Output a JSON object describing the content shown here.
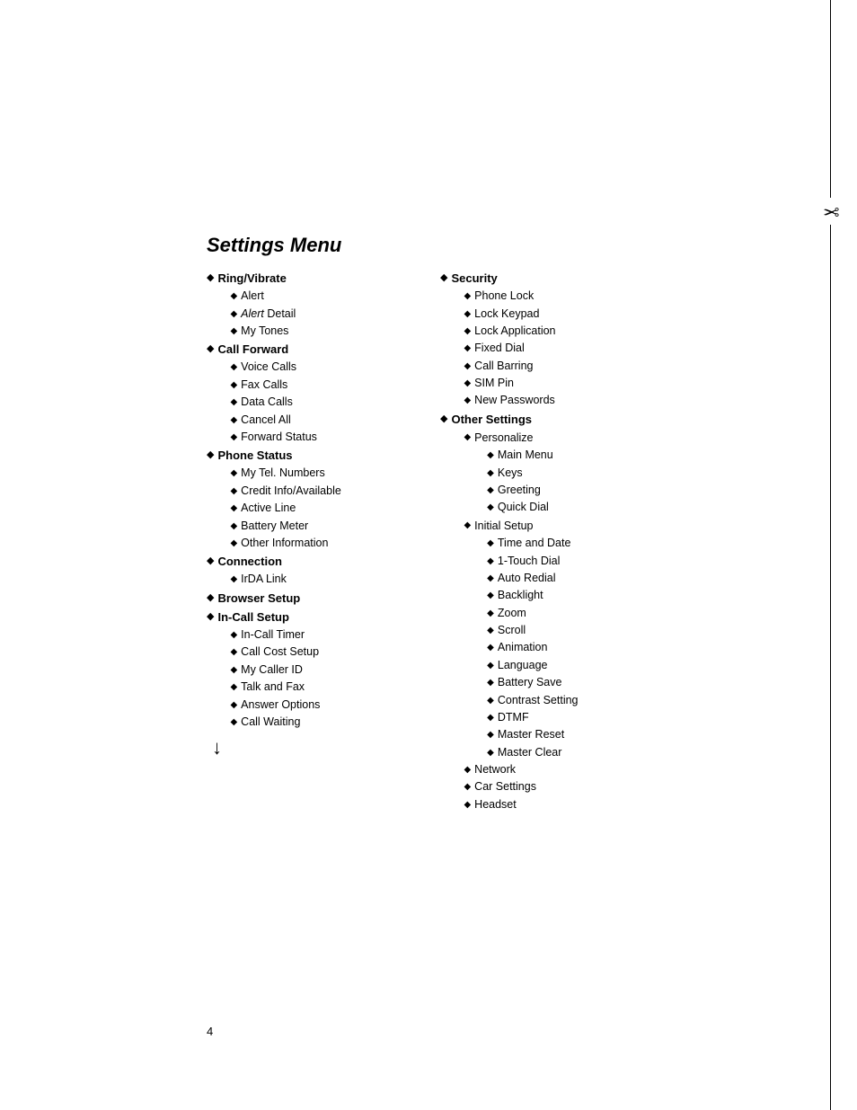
{
  "title": "Settings Menu",
  "page_number": "4",
  "left_column": {
    "sections": [
      {
        "label": "Ring/Vibrate",
        "bold": true,
        "children": [
          {
            "label": "Alert",
            "style": "normal"
          },
          {
            "label": "Alert",
            "style": "italic-prefix",
            "suffix": " Detail"
          },
          {
            "label": "My Tones",
            "style": "normal"
          }
        ]
      },
      {
        "label": "Call Forward",
        "bold": true,
        "children": [
          {
            "label": "Voice Calls",
            "style": "normal"
          },
          {
            "label": "Fax Calls",
            "style": "normal"
          },
          {
            "label": "Data Calls",
            "style": "normal"
          },
          {
            "label": "Cancel All",
            "style": "normal"
          },
          {
            "label": "Forward Status",
            "style": "normal"
          }
        ]
      },
      {
        "label": "Phone Status",
        "bold": true,
        "children": [
          {
            "label": "My Tel. Numbers",
            "style": "normal"
          },
          {
            "label": "Credit Info/Available",
            "style": "normal"
          },
          {
            "label": "Active Line",
            "style": "normal"
          },
          {
            "label": "Battery Meter",
            "style": "normal"
          },
          {
            "label": "Other Information",
            "style": "normal"
          }
        ]
      },
      {
        "label": "Connection",
        "bold": true,
        "children": [
          {
            "label": "IrDA Link",
            "style": "normal"
          }
        ]
      },
      {
        "label": "Browser Setup",
        "bold": true,
        "children": []
      },
      {
        "label": "In-Call Setup",
        "bold": true,
        "children": [
          {
            "label": "In-Call Timer",
            "style": "normal"
          },
          {
            "label": "Call Cost Setup",
            "style": "normal"
          },
          {
            "label": "My Caller ID",
            "style": "normal"
          },
          {
            "label": "Talk and Fax",
            "style": "normal"
          },
          {
            "label": "Answer Options",
            "style": "normal"
          },
          {
            "label": "Call Waiting",
            "style": "normal"
          }
        ]
      }
    ]
  },
  "right_column": {
    "sections": [
      {
        "label": "Security",
        "bold": true,
        "children": [
          {
            "label": "Phone Lock",
            "style": "normal"
          },
          {
            "label": "Lock Keypad",
            "style": "normal"
          },
          {
            "label": "Lock Application",
            "style": "normal"
          },
          {
            "label": "Fixed Dial",
            "style": "normal"
          },
          {
            "label": "Call Barring",
            "style": "normal"
          },
          {
            "label": "SIM Pin",
            "style": "normal"
          },
          {
            "label": "New Passwords",
            "style": "normal"
          }
        ]
      },
      {
        "label": "Other Settings",
        "bold": true,
        "children": [
          {
            "label": "Personalize",
            "style": "normal",
            "children": [
              {
                "label": "Main Menu"
              },
              {
                "label": "Keys"
              },
              {
                "label": "Greeting"
              },
              {
                "label": "Quick Dial"
              }
            ]
          },
          {
            "label": "Initial Setup",
            "style": "normal",
            "children": [
              {
                "label": "Time and Date"
              },
              {
                "label": "1-Touch Dial"
              },
              {
                "label": "Auto Redial"
              },
              {
                "label": "Backlight"
              },
              {
                "label": "Zoom"
              },
              {
                "label": "Scroll"
              },
              {
                "label": "Animation"
              },
              {
                "label": "Language"
              },
              {
                "label": "Battery Save"
              },
              {
                "label": "Contrast Setting"
              },
              {
                "label": "DTMF"
              },
              {
                "label": "Master Reset"
              },
              {
                "label": "Master Clear"
              }
            ]
          },
          {
            "label": "Network",
            "style": "normal"
          },
          {
            "label": "Car Settings",
            "style": "normal"
          },
          {
            "label": "Headset",
            "style": "normal"
          }
        ]
      }
    ]
  }
}
